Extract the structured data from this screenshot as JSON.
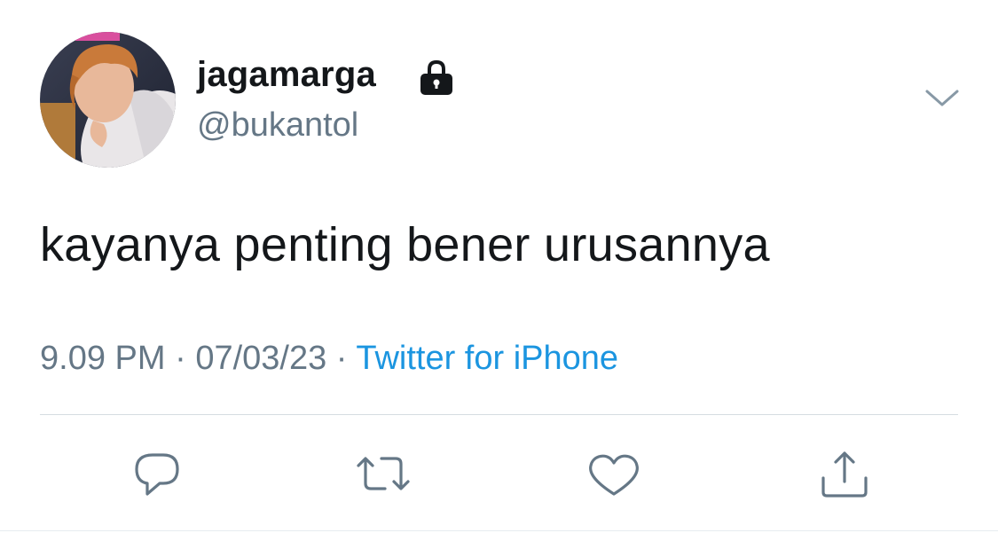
{
  "user": {
    "display_name": "jagamarga",
    "handle": "@bukantol",
    "protected": true
  },
  "tweet": {
    "text": "kayanya penting bener urusannya",
    "time": "9.09 PM",
    "separator": "·",
    "date": "07/03/23",
    "source": "Twitter for iPhone"
  },
  "icons": {
    "lock": "lock-icon",
    "chevron": "chevron-down-icon",
    "reply": "reply-icon",
    "retweet": "retweet-icon",
    "like": "heart-icon",
    "share": "share-icon"
  },
  "colors": {
    "text": "#14171a",
    "secondary": "#657786",
    "link": "#1b95e0",
    "divider": "#d6dce1"
  }
}
